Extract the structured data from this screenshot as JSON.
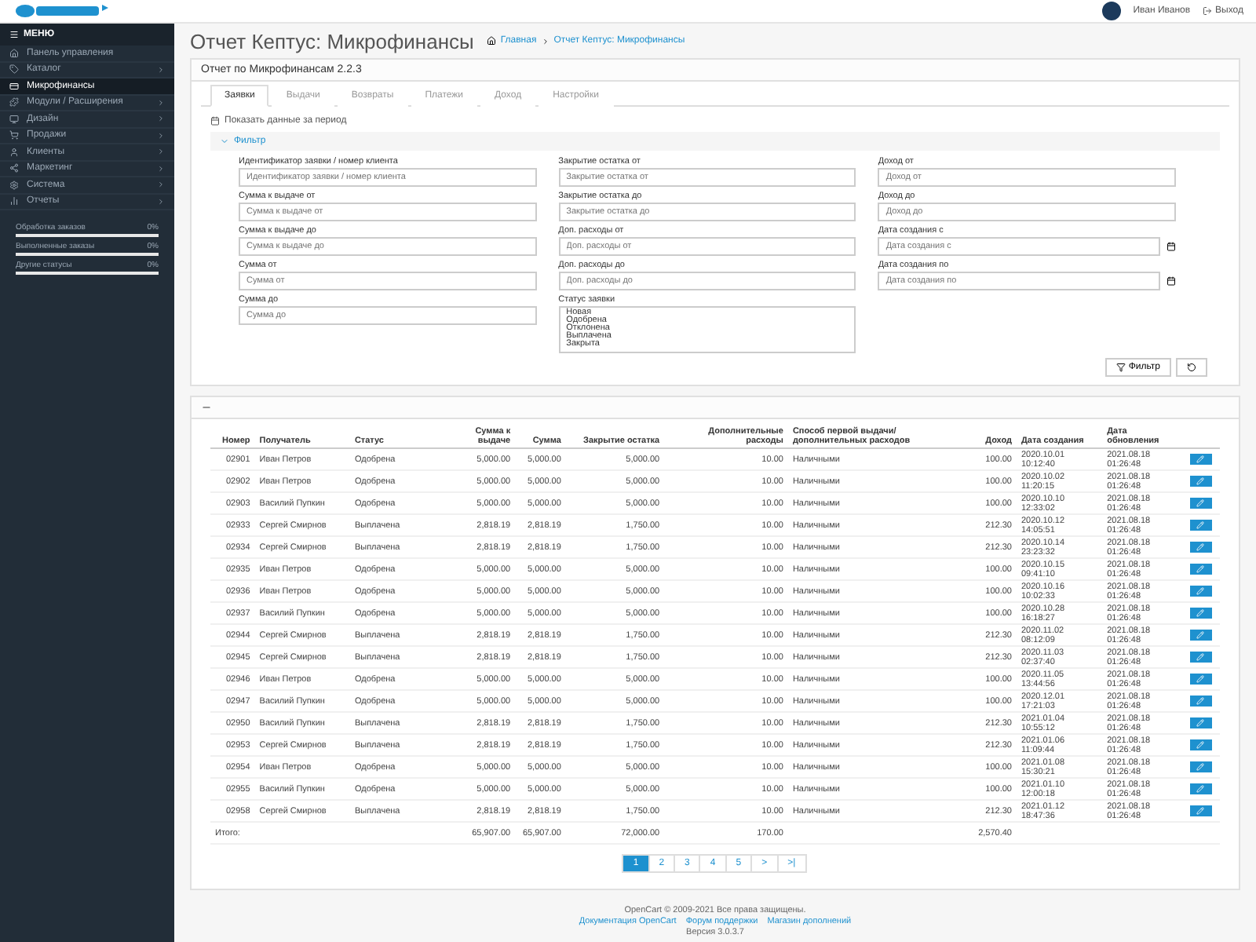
{
  "header": {
    "user": "Иван Иванов",
    "logout": "Выход"
  },
  "sidebar": {
    "title": "МЕНЮ",
    "items": [
      {
        "label": "Панель управления",
        "selected": false,
        "has_children": false
      },
      {
        "label": "Каталог",
        "selected": false,
        "has_children": true
      },
      {
        "label": "Микрофинансы",
        "selected": true,
        "has_children": false
      },
      {
        "label": "Модули / Расширения",
        "selected": false,
        "has_children": true
      },
      {
        "label": "Дизайн",
        "selected": false,
        "has_children": true
      },
      {
        "label": "Продажи",
        "selected": false,
        "has_children": true
      },
      {
        "label": "Клиенты",
        "selected": false,
        "has_children": true
      },
      {
        "label": "Маркетинг",
        "selected": false,
        "has_children": true
      },
      {
        "label": "Система",
        "selected": false,
        "has_children": true
      },
      {
        "label": "Отчеты",
        "selected": false,
        "has_children": true
      }
    ],
    "stats": [
      {
        "label": "Обработка заказов",
        "value": "0%",
        "level": 0
      },
      {
        "label": "Выполненные заказы",
        "value": "0%",
        "level": 0
      },
      {
        "label": "Другие статусы",
        "value": "0%",
        "level": 0
      }
    ]
  },
  "page": {
    "title": "Отчет Кептус: Микрофинансы",
    "breadcrumbs": [
      "Главная",
      "Отчет Кептус: Микрофинансы"
    ]
  },
  "panel": {
    "title": "Отчет по Микрофинансам 2.2.3",
    "tabs": [
      {
        "label": "Заявки",
        "selected": true
      },
      {
        "label": "Выдачи",
        "selected": false
      },
      {
        "label": "Возвраты",
        "selected": false
      },
      {
        "label": "Платежи",
        "selected": false
      },
      {
        "label": "Доход",
        "selected": false
      },
      {
        "label": "Настройки",
        "selected": false
      }
    ],
    "period": "Показать данные за период",
    "filter": {
      "title": "Фильтр",
      "expanded": true,
      "columns": [
        [
          {
            "label": "Идентификатор заявки / номер клиента",
            "placeholder": "Идентификатор заявки / номер клиента"
          },
          {
            "label": "Сумма к выдаче от",
            "placeholder": "Сумма к выдаче от"
          },
          {
            "label": "Сумма к выдаче до",
            "placeholder": "Сумма к выдаче до"
          },
          {
            "label": "Сумма от",
            "placeholder": "Сумма от"
          },
          {
            "label": "Сумма до",
            "placeholder": "Сумма до"
          }
        ],
        [
          {
            "label": "Закрытие остатка от",
            "placeholder": "Закрытие остатка от"
          },
          {
            "label": "Закрытие остатка до",
            "placeholder": "Закрытие остатка до"
          },
          {
            "label": "Доп. расходы от",
            "placeholder": "Доп. расходы от"
          },
          {
            "label": "Доп. расходы до",
            "placeholder": "Доп. расходы до"
          },
          {
            "label": "Статус заявки",
            "kind": "list",
            "options": [
              "Новая",
              "Одобрена",
              "Отклонена",
              "Выплачена",
              "Закрыта"
            ]
          }
        ],
        [
          {
            "label": "Доход от",
            "placeholder": "Доход от"
          },
          {
            "label": "Доход до",
            "placeholder": "Доход до"
          },
          {
            "label": "Дата создания с",
            "placeholder": "Дата создания с",
            "kind": "date"
          },
          {
            "label": "Дата создания по",
            "placeholder": "Дата создания по",
            "kind": "date"
          }
        ]
      ],
      "button": "Фильтр"
    }
  },
  "table": {
    "columns": [
      "Номер",
      "Получатель",
      "Статус",
      "Сумма к выдаче",
      "Сумма",
      "Закрытие остатка",
      "Дополнительные расходы",
      "Способ первой выдачи/дополнительных расходов",
      "Доход",
      "Дата создания",
      "Дата обновления"
    ],
    "rows": [
      {
        "number": "02901",
        "recipient": "Иван Петров",
        "status": "Одобрена",
        "payout": "5,000.00",
        "amount": "5,000.00",
        "closing": "5,000.00",
        "extra": "10.00",
        "method": "Наличными",
        "income": "100.00",
        "created": "2020.10.01 10:12:40",
        "updated": "2021.08.18 01:26:48"
      },
      {
        "number": "02902",
        "recipient": "Иван Петров",
        "status": "Одобрена",
        "payout": "5,000.00",
        "amount": "5,000.00",
        "closing": "5,000.00",
        "extra": "10.00",
        "method": "Наличными",
        "income": "100.00",
        "created": "2020.10.02 11:20:15",
        "updated": "2021.08.18 01:26:48"
      },
      {
        "number": "02903",
        "recipient": "Василий Пупкин",
        "status": "Одобрена",
        "payout": "5,000.00",
        "amount": "5,000.00",
        "closing": "5,000.00",
        "extra": "10.00",
        "method": "Наличными",
        "income": "100.00",
        "created": "2020.10.10 12:33:02",
        "updated": "2021.08.18 01:26:48"
      },
      {
        "number": "02933",
        "recipient": "Сергей Смирнов",
        "status": "Выплачена",
        "payout": "2,818.19",
        "amount": "2,818.19",
        "closing": "1,750.00",
        "extra": "10.00",
        "method": "Наличными",
        "income": "212.30",
        "created": "2020.10.12 14:05:51",
        "updated": "2021.08.18 01:26:48"
      },
      {
        "number": "02934",
        "recipient": "Сергей Смирнов",
        "status": "Выплачена",
        "payout": "2,818.19",
        "amount": "2,818.19",
        "closing": "1,750.00",
        "extra": "10.00",
        "method": "Наличными",
        "income": "212.30",
        "created": "2020.10.14 23:23:32",
        "updated": "2021.08.18 01:26:48"
      },
      {
        "number": "02935",
        "recipient": "Иван Петров",
        "status": "Одобрена",
        "payout": "5,000.00",
        "amount": "5,000.00",
        "closing": "5,000.00",
        "extra": "10.00",
        "method": "Наличными",
        "income": "100.00",
        "created": "2020.10.15 09:41:10",
        "updated": "2021.08.18 01:26:48"
      },
      {
        "number": "02936",
        "recipient": "Иван Петров",
        "status": "Одобрена",
        "payout": "5,000.00",
        "amount": "5,000.00",
        "closing": "5,000.00",
        "extra": "10.00",
        "method": "Наличными",
        "income": "100.00",
        "created": "2020.10.16 10:02:33",
        "updated": "2021.08.18 01:26:48"
      },
      {
        "number": "02937",
        "recipient": "Василий Пупкин",
        "status": "Одобрена",
        "payout": "5,000.00",
        "amount": "5,000.00",
        "closing": "5,000.00",
        "extra": "10.00",
        "method": "Наличными",
        "income": "100.00",
        "created": "2020.10.28 16:18:27",
        "updated": "2021.08.18 01:26:48"
      },
      {
        "number": "02944",
        "recipient": "Сергей Смирнов",
        "status": "Выплачена",
        "payout": "2,818.19",
        "amount": "2,818.19",
        "closing": "1,750.00",
        "extra": "10.00",
        "method": "Наличными",
        "income": "212.30",
        "created": "2020.11.02 08:12:09",
        "updated": "2021.08.18 01:26:48"
      },
      {
        "number": "02945",
        "recipient": "Сергей Смирнов",
        "status": "Выплачена",
        "payout": "2,818.19",
        "amount": "2,818.19",
        "closing": "1,750.00",
        "extra": "10.00",
        "method": "Наличными",
        "income": "212.30",
        "created": "2020.11.03 02:37:40",
        "updated": "2021.08.18 01:26:48"
      },
      {
        "number": "02946",
        "recipient": "Иван Петров",
        "status": "Одобрена",
        "payout": "5,000.00",
        "amount": "5,000.00",
        "closing": "5,000.00",
        "extra": "10.00",
        "method": "Наличными",
        "income": "100.00",
        "created": "2020.11.05 13:44:56",
        "updated": "2021.08.18 01:26:48"
      },
      {
        "number": "02947",
        "recipient": "Василий Пупкин",
        "status": "Одобрена",
        "payout": "5,000.00",
        "amount": "5,000.00",
        "closing": "5,000.00",
        "extra": "10.00",
        "method": "Наличными",
        "income": "100.00",
        "created": "2020.12.01 17:21:03",
        "updated": "2021.08.18 01:26:48"
      },
      {
        "number": "02950",
        "recipient": "Василий Пупкин",
        "status": "Выплачена",
        "payout": "2,818.19",
        "amount": "2,818.19",
        "closing": "1,750.00",
        "extra": "10.00",
        "method": "Наличными",
        "income": "212.30",
        "created": "2021.01.04 10:55:12",
        "updated": "2021.08.18 01:26:48"
      },
      {
        "number": "02953",
        "recipient": "Сергей Смирнов",
        "status": "Выплачена",
        "payout": "2,818.19",
        "amount": "2,818.19",
        "closing": "1,750.00",
        "extra": "10.00",
        "method": "Наличными",
        "income": "212.30",
        "created": "2021.01.06 11:09:44",
        "updated": "2021.08.18 01:26:48"
      },
      {
        "number": "02954",
        "recipient": "Иван Петров",
        "status": "Одобрена",
        "payout": "5,000.00",
        "amount": "5,000.00",
        "closing": "5,000.00",
        "extra": "10.00",
        "method": "Наличными",
        "income": "100.00",
        "created": "2021.01.08 15:30:21",
        "updated": "2021.08.18 01:26:48"
      },
      {
        "number": "02955",
        "recipient": "Василий Пупкин",
        "status": "Одобрена",
        "payout": "5,000.00",
        "amount": "5,000.00",
        "closing": "5,000.00",
        "extra": "10.00",
        "method": "Наличными",
        "income": "100.00",
        "created": "2021.01.10 12:00:18",
        "updated": "2021.08.18 01:26:48"
      },
      {
        "number": "02958",
        "recipient": "Сергей Смирнов",
        "status": "Выплачена",
        "payout": "2,818.19",
        "amount": "2,818.19",
        "closing": "1,750.00",
        "extra": "10.00",
        "method": "Наличными",
        "income": "212.30",
        "created": "2021.01.12 18:47:36",
        "updated": "2021.08.18 01:26:48"
      }
    ],
    "totals": {
      "label": "Итого:",
      "payout": "65,907.00",
      "amount": "65,907.00",
      "closing": "72,000.00",
      "extra": "170.00",
      "income": "2,570.40"
    }
  },
  "pagination": [
    {
      "label": "1",
      "selected": true
    },
    {
      "label": "2",
      "selected": false
    },
    {
      "label": "3",
      "selected": false
    },
    {
      "label": "4",
      "selected": false
    },
    {
      "label": "5",
      "selected": false
    },
    {
      "label": ">",
      "selected": false
    },
    {
      "label": ">|",
      "selected": false
    }
  ],
  "footer": {
    "line1": "OpenCart © 2009-2021 Все права защищены.",
    "links": [
      "Документация OpenCart",
      "Форум поддержки",
      "Магазин дополнений"
    ],
    "version": "Версия 3.0.3.7"
  }
}
